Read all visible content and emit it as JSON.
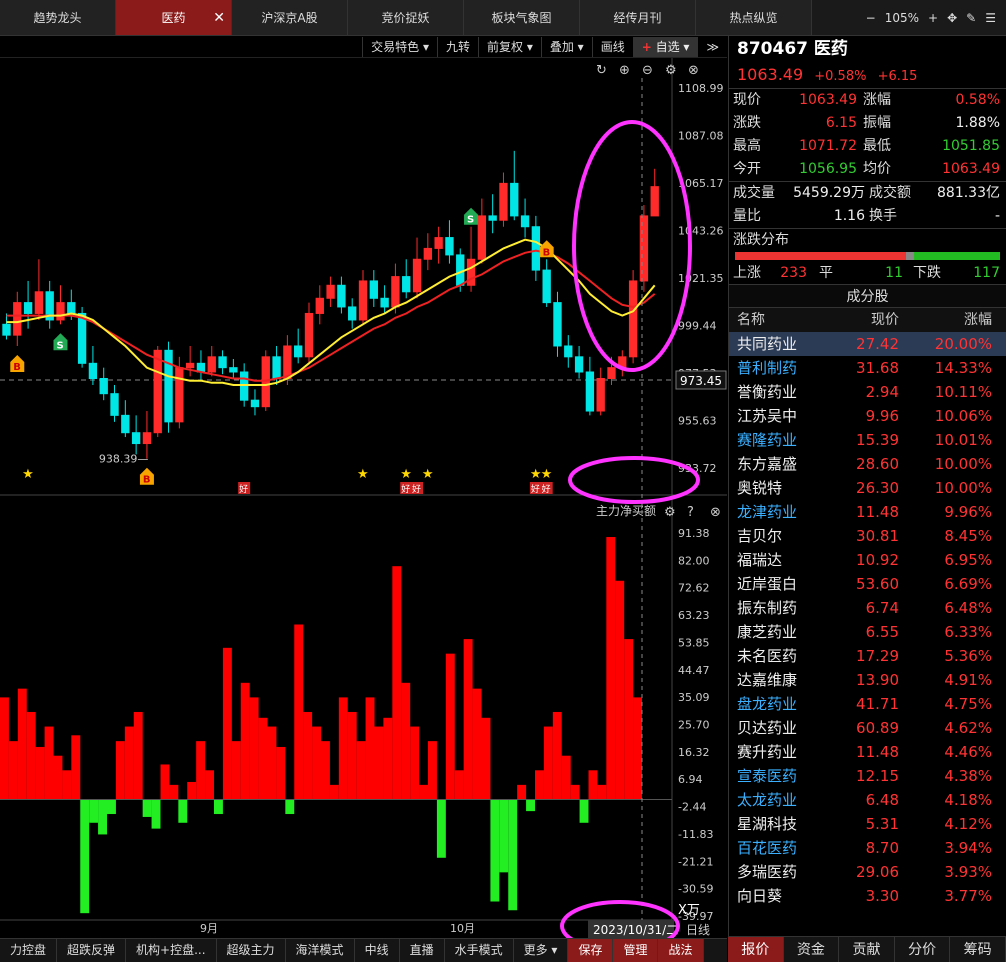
{
  "tabs": [
    {
      "label": "趋势龙头",
      "active": false
    },
    {
      "label": "医药",
      "active": true
    },
    {
      "label": "沪深京A股",
      "active": false
    },
    {
      "label": "竞价捉妖",
      "active": false
    },
    {
      "label": "板块气象图",
      "active": false
    },
    {
      "label": "经传月刊",
      "active": false
    },
    {
      "label": "热点纵览",
      "active": false
    }
  ],
  "tab_close": "✕",
  "zoom": {
    "minus": "−",
    "level": "105%",
    "plus": "+"
  },
  "toolbar": {
    "items": [
      "交易特色 ▾",
      "九转",
      "前复权 ▾",
      "叠加 ▾",
      "画线"
    ],
    "fav_plus": "+",
    "fav_label": "自选 ▾",
    "more": "≫"
  },
  "main_chart": {
    "y_labels": [
      "1108.99",
      "1087.08",
      "1065.17",
      "1043.26",
      "1021.35",
      "999.44",
      "977.53",
      "955.63",
      "933.72"
    ],
    "current_price_tag": "973.45",
    "low_label": "938.39",
    "good_tag": "好",
    "buy_tag": "B",
    "sell_tag": "S"
  },
  "sub_chart": {
    "title": "主力净买额",
    "y_labels": [
      "91.38",
      "82.00",
      "72.62",
      "63.23",
      "53.85",
      "44.47",
      "35.09",
      "25.70",
      "16.32",
      "6.94",
      "-2.44",
      "-11.83",
      "-21.21",
      "-30.59",
      "-39.97"
    ],
    "unit": "X万",
    "x_labels": [
      "9月",
      "10月"
    ],
    "date": "2023/10/31/二",
    "period": "日线"
  },
  "chart_data": [
    {
      "type": "candlestick",
      "title": "",
      "ylim": [
        933.72,
        1108.99
      ],
      "series": [
        {
          "name": "candles",
          "values": [
            [
              1000,
              995,
              1005,
              993
            ],
            [
              995,
              1010,
              1015,
              990
            ],
            [
              1010,
              1005,
              1020,
              998
            ],
            [
              1005,
              1015,
              1030,
              1002
            ],
            [
              1015,
              1002,
              1020,
              998
            ],
            [
              1002,
              1010,
              1018,
              1000
            ],
            [
              1010,
              1005,
              1016,
              1002
            ],
            [
              1005,
              982,
              1008,
              980
            ],
            [
              982,
              975,
              990,
              972
            ],
            [
              975,
              968,
              980,
              965
            ],
            [
              968,
              958,
              972,
              955
            ],
            [
              958,
              950,
              965,
              948
            ],
            [
              950,
              945,
              958,
              940
            ],
            [
              945,
              950,
              960,
              938
            ],
            [
              950,
              988,
              990,
              948
            ],
            [
              988,
              955,
              992,
              950
            ],
            [
              955,
              980,
              985,
              952
            ],
            [
              980,
              982,
              990,
              976
            ],
            [
              982,
              978,
              988,
              974
            ],
            [
              978,
              985,
              990,
              976
            ],
            [
              985,
              980,
              988,
              977
            ],
            [
              980,
              978,
              984,
              975
            ],
            [
              978,
              965,
              982,
              962
            ],
            [
              965,
              962,
              970,
              958
            ],
            [
              962,
              985,
              988,
              960
            ],
            [
              985,
              975,
              990,
              972
            ],
            [
              975,
              990,
              995,
              972
            ],
            [
              990,
              985,
              998,
              982
            ],
            [
              985,
              1005,
              1010,
              982
            ],
            [
              1005,
              1012,
              1018,
              1000
            ],
            [
              1012,
              1018,
              1022,
              1008
            ],
            [
              1018,
              1008,
              1022,
              1005
            ],
            [
              1008,
              1002,
              1012,
              998
            ],
            [
              1002,
              1020,
              1025,
              1000
            ],
            [
              1020,
              1012,
              1025,
              1008
            ],
            [
              1012,
              1008,
              1018,
              1005
            ],
            [
              1008,
              1022,
              1028,
              1005
            ],
            [
              1022,
              1015,
              1030,
              1012
            ],
            [
              1015,
              1030,
              1040,
              1012
            ],
            [
              1030,
              1035,
              1042,
              1025
            ],
            [
              1035,
              1040,
              1045,
              1028
            ],
            [
              1040,
              1032,
              1048,
              1028
            ],
            [
              1032,
              1018,
              1035,
              1015
            ],
            [
              1018,
              1030,
              1045,
              1015
            ],
            [
              1030,
              1050,
              1058,
              1028
            ],
            [
              1050,
              1048,
              1060,
              1042
            ],
            [
              1048,
              1065,
              1070,
              1045
            ],
            [
              1065,
              1050,
              1080,
              1048
            ],
            [
              1050,
              1045,
              1058,
              1040
            ],
            [
              1045,
              1025,
              1050,
              1020
            ],
            [
              1025,
              1010,
              1030,
              1008
            ],
            [
              1010,
              990,
              1015,
              985
            ],
            [
              990,
              985,
              995,
              980
            ],
            [
              985,
              978,
              990,
              975
            ],
            [
              978,
              960,
              985,
              958
            ],
            [
              960,
              975,
              980,
              958
            ],
            [
              975,
              980,
              985,
              972
            ],
            [
              980,
              985,
              988,
              976
            ],
            [
              985,
              1020,
              1025,
              982
            ],
            [
              1020,
              1050,
              1055,
              1015
            ],
            [
              1050,
              1063.49,
              1071.72,
              1051.85
            ]
          ]
        },
        {
          "name": "MA-yellow",
          "values": [
            1001,
            1001,
            1002,
            1003,
            1004,
            1004,
            1005,
            1004,
            1002,
            998,
            994,
            990,
            985,
            980,
            978,
            976,
            975,
            974,
            974,
            973,
            973,
            972,
            972,
            972,
            972,
            973,
            975,
            978,
            982,
            986,
            990,
            994,
            997,
            1000,
            1003,
            1005,
            1008,
            1010,
            1013,
            1016,
            1019,
            1022,
            1024,
            1026,
            1029,
            1032,
            1035,
            1037,
            1039,
            1038,
            1035,
            1030,
            1025,
            1020,
            1014,
            1010,
            1006,
            1004,
            1006,
            1012,
            1018
          ]
        },
        {
          "name": "MA-red",
          "values": [
            1004,
            1004,
            1004,
            1004,
            1004,
            1004,
            1004,
            1003,
            1001,
            998,
            995,
            992,
            989,
            986,
            984,
            982,
            980,
            979,
            978,
            977,
            976,
            975,
            975,
            974,
            974,
            975,
            976,
            978,
            980,
            983,
            986,
            989,
            992,
            995,
            998,
            1000,
            1003,
            1005,
            1008,
            1010,
            1013,
            1016,
            1018,
            1021,
            1023,
            1026,
            1029,
            1031,
            1033,
            1034,
            1033,
            1031,
            1028,
            1024,
            1020,
            1016,
            1012,
            1009,
            1008,
            1010,
            1014
          ]
        }
      ]
    },
    {
      "type": "bar",
      "title": "主力净买额",
      "ylim": [
        -39.97,
        91.38
      ],
      "values": [
        35,
        20,
        38,
        30,
        18,
        25,
        15,
        10,
        22,
        -39,
        -8,
        -12,
        -5,
        20,
        25,
        30,
        -6,
        -10,
        12,
        5,
        -8,
        6,
        20,
        10,
        -5,
        52,
        20,
        40,
        35,
        28,
        25,
        18,
        -5,
        60,
        30,
        25,
        20,
        5,
        35,
        30,
        20,
        35,
        25,
        28,
        80,
        40,
        25,
        5,
        20,
        -20,
        50,
        10,
        55,
        38,
        28,
        -35,
        -25,
        -38,
        5,
        -4,
        10,
        25,
        30,
        15,
        5,
        -8,
        10,
        5,
        90,
        75,
        55,
        35
      ]
    }
  ],
  "quote": {
    "code": "870467",
    "name": "医药",
    "price": "1063.49",
    "pct": "+0.58%",
    "chg": "+6.15",
    "rows": [
      {
        "k": "现价",
        "v": "1063.49",
        "vc": "red",
        "k2": "涨幅",
        "v2": "0.58%",
        "v2c": "red"
      },
      {
        "k": "涨跌",
        "v": "6.15",
        "vc": "red",
        "k2": "振幅",
        "v2": "1.88%",
        "v2c": "white"
      },
      {
        "k": "最高",
        "v": "1071.72",
        "vc": "red",
        "k2": "最低",
        "v2": "1051.85",
        "v2c": "green"
      },
      {
        "k": "今开",
        "v": "1056.95",
        "vc": "green",
        "k2": "均价",
        "v2": "1063.49",
        "v2c": "red"
      }
    ],
    "vol_label": "成交量",
    "vol": "5459.29万",
    "amt_label": "成交额",
    "amt": "881.33亿",
    "ratio_label": "量比",
    "ratio": "1.16",
    "turn_label": "换手",
    "turn": "-"
  },
  "distribution": {
    "title": "涨跌分布",
    "up_label": "上涨",
    "up": "233",
    "flat_label": "平",
    "flat": "11",
    "down_label": "下跌",
    "down": "117"
  },
  "components": {
    "title": "成分股",
    "headers": [
      "名称",
      "现价",
      "涨幅"
    ],
    "rows": [
      {
        "name": "共同药业",
        "price": "27.42",
        "pct": "20.00%",
        "nc": "n-white",
        "sel": true
      },
      {
        "name": "普利制药",
        "price": "31.68",
        "pct": "14.33%",
        "nc": "n-blue"
      },
      {
        "name": "誉衡药业",
        "price": "2.94",
        "pct": "10.11%",
        "nc": "n-white"
      },
      {
        "name": "江苏吴中",
        "price": "9.96",
        "pct": "10.06%",
        "nc": "n-white"
      },
      {
        "name": "赛隆药业",
        "price": "15.39",
        "pct": "10.01%",
        "nc": "n-blue"
      },
      {
        "name": "东方嘉盛",
        "price": "28.60",
        "pct": "10.00%",
        "nc": "n-white"
      },
      {
        "name": "奥锐特",
        "price": "26.30",
        "pct": "10.00%",
        "nc": "n-white"
      },
      {
        "name": "龙津药业",
        "price": "11.48",
        "pct": "9.96%",
        "nc": "n-blue"
      },
      {
        "name": "吉贝尔",
        "price": "30.81",
        "pct": "8.45%",
        "nc": "n-white"
      },
      {
        "name": "福瑞达",
        "price": "10.92",
        "pct": "6.95%",
        "nc": "n-white"
      },
      {
        "name": "近岸蛋白",
        "price": "53.60",
        "pct": "6.69%",
        "nc": "n-white"
      },
      {
        "name": "振东制药",
        "price": "6.74",
        "pct": "6.48%",
        "nc": "n-white"
      },
      {
        "name": "康芝药业",
        "price": "6.55",
        "pct": "6.33%",
        "nc": "n-white"
      },
      {
        "name": "未名医药",
        "price": "17.29",
        "pct": "5.36%",
        "nc": "n-white"
      },
      {
        "name": "达嘉维康",
        "price": "13.90",
        "pct": "4.91%",
        "nc": "n-white"
      },
      {
        "name": "盘龙药业",
        "price": "41.71",
        "pct": "4.75%",
        "nc": "n-blue"
      },
      {
        "name": "贝达药业",
        "price": "60.89",
        "pct": "4.62%",
        "nc": "n-white"
      },
      {
        "name": "赛升药业",
        "price": "11.48",
        "pct": "4.46%",
        "nc": "n-white"
      },
      {
        "name": "宣泰医药",
        "price": "12.15",
        "pct": "4.38%",
        "nc": "n-blue"
      },
      {
        "name": "太龙药业",
        "price": "6.48",
        "pct": "4.18%",
        "nc": "n-blue"
      },
      {
        "name": "星湖科技",
        "price": "5.31",
        "pct": "4.12%",
        "nc": "n-white"
      },
      {
        "name": "百花医药",
        "price": "8.70",
        "pct": "3.94%",
        "nc": "n-blue"
      },
      {
        "name": "多瑞医药",
        "price": "29.06",
        "pct": "3.93%",
        "nc": "n-white"
      },
      {
        "name": "向日葵",
        "price": "3.30",
        "pct": "3.77%",
        "nc": "n-white"
      }
    ]
  },
  "bottom_tabs": [
    "力控盘",
    "超跌反弹",
    "机构+控盘...",
    "超级主力",
    "海洋模式",
    "中线",
    "直播",
    "水手模式",
    "更多 ▾"
  ],
  "bottom_buttons": [
    "保存",
    "管理",
    "战法"
  ],
  "right_tabs": [
    {
      "label": "报价",
      "active": true
    },
    {
      "label": "资金",
      "active": false
    },
    {
      "label": "贡献",
      "active": false
    },
    {
      "label": "分价",
      "active": false
    },
    {
      "label": "筹码",
      "active": false
    }
  ],
  "colors": {
    "up": "#ff2a2a",
    "down": "#00e5e5",
    "bar_up": "#ff0000",
    "bar_down": "#22ee22",
    "ma1": "#ffee33",
    "ma2": "#ee2222",
    "highlight": "#ff33ff"
  }
}
